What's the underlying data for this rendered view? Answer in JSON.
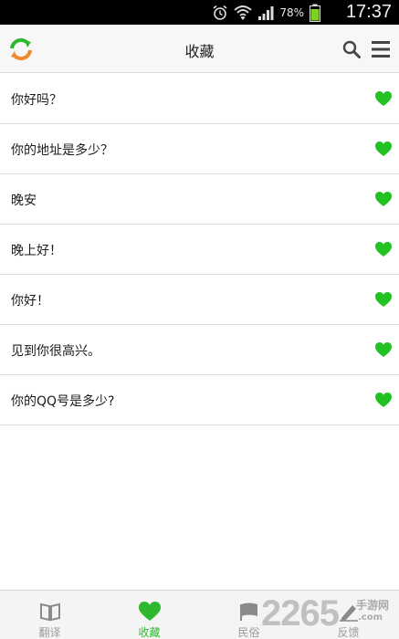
{
  "status_bar": {
    "battery": "78%",
    "time": "17:37"
  },
  "app_bar": {
    "title": "收藏"
  },
  "favorites": [
    {
      "text": "你好吗？"
    },
    {
      "text": "你的地址是多少？"
    },
    {
      "text": "晚安"
    },
    {
      "text": "晚上好！"
    },
    {
      "text": "你好！"
    },
    {
      "text": "见到你很高兴。"
    },
    {
      "text": "你的QQ号是多少?"
    }
  ],
  "tabs": [
    {
      "label": "翻译",
      "icon": "book-icon"
    },
    {
      "label": "收藏",
      "icon": "heart-icon",
      "active": true
    },
    {
      "label": "民俗",
      "icon": "flag-icon"
    },
    {
      "label": "反馈",
      "icon": "pencil-icon"
    }
  ],
  "watermark": {
    "big": "2265",
    "small": "手游网",
    "com": ".com"
  },
  "colors": {
    "accent": "#2fb82f",
    "heart": "#22c222",
    "logo_orange": "#f08a2a"
  }
}
